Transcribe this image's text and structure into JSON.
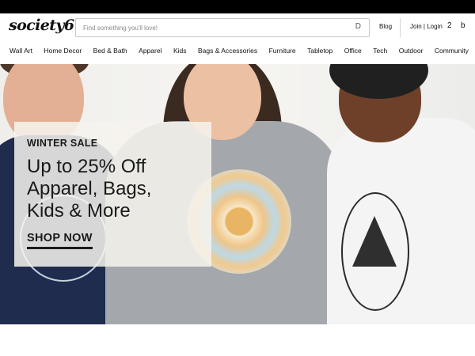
{
  "header": {
    "logo": "society6",
    "search_placeholder": "Find something you'll love!",
    "search_icon": "D",
    "blog": "Blog",
    "join_login": "Join | Login",
    "cart_count": "2",
    "bag_icon": "b"
  },
  "nav": {
    "items": [
      "Wall Art",
      "Home Decor",
      "Bed & Bath",
      "Apparel",
      "Kids",
      "Bags & Accessories",
      "Furniture",
      "Tabletop",
      "Office",
      "Tech",
      "Outdoor",
      "Community"
    ]
  },
  "hero": {
    "kicker": "WINTER SALE",
    "headline_lines": [
      "Up to 25% Off",
      "Apparel, Bags,",
      "Kids & More"
    ],
    "cta": "SHOP NOW"
  },
  "colors": {
    "topbar": "#000000",
    "text": "#111111",
    "promo_panel": "#f6f3ee"
  }
}
